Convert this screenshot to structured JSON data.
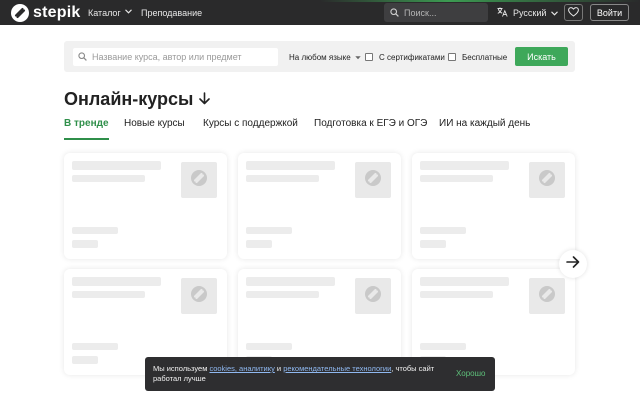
{
  "header": {
    "logo_text": "stepik",
    "nav_catalog": "Каталог",
    "nav_teaching": "Преподавание",
    "search_placeholder": "Поиск...",
    "language": "Русский",
    "login_label": "Войти"
  },
  "search_panel": {
    "placeholder": "Название курса, автор или предмет",
    "language_filter": "На любом языке",
    "cert_label": "С сертификатами",
    "free_label": "Бесплатные",
    "search_button": "Искать"
  },
  "main": {
    "title": "Онлайн-курсы",
    "tabs": [
      {
        "label": "В тренде",
        "active": true
      },
      {
        "label": "Новые курсы",
        "active": false
      },
      {
        "label": "Курсы с поддержкой",
        "active": false
      },
      {
        "label": "Подготовка к ЕГЭ и ОГЭ",
        "active": false
      },
      {
        "label": "ИИ на каждый день",
        "active": false
      }
    ]
  },
  "cookie_banner": {
    "text_before": "Мы используем ",
    "link1": "cookies, аналитику",
    "text_mid": " и ",
    "link2": "рекомендательные технологии",
    "text_after": ", чтобы сайт работал лучше",
    "ok_label": "Хорошо"
  },
  "colors": {
    "accent_green": "#3ea85a",
    "header_bg": "#2a2a2b",
    "link_blue": "#8fb8f0"
  }
}
